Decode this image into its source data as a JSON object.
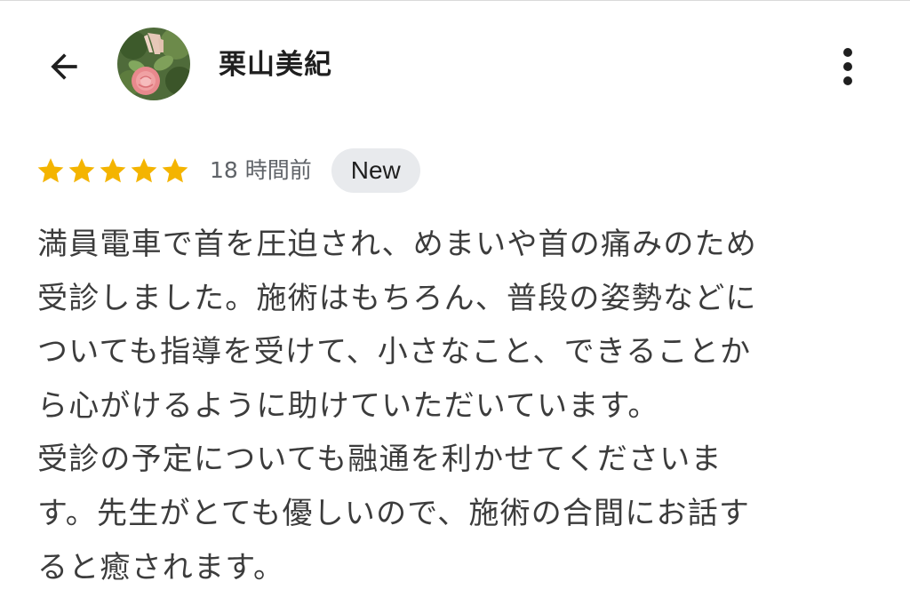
{
  "header": {
    "back_icon": "arrow-left-icon",
    "avatar_icon": "profile-photo-rose",
    "reviewer_name": "栗山美紀",
    "more_icon": "more-vertical-icon"
  },
  "rating": {
    "stars": 5,
    "max_stars": 5,
    "star_color": "#f4b400",
    "time_ago": "18 時間前",
    "badge": "New"
  },
  "review": {
    "lines": [
      "満員電車で首を圧迫され、めまいや首の痛みのため",
      "受診しました。施術はもちろん、普段の姿勢などに",
      "ついても指導を受けて、小さなこと、できることか",
      "ら心がけるように助けていただいています。",
      "受診の予定についても融通を利かせてくださいま",
      "す。先生がとても優しいので、施術の合間にお話す",
      "ると癒されます。"
    ]
  }
}
